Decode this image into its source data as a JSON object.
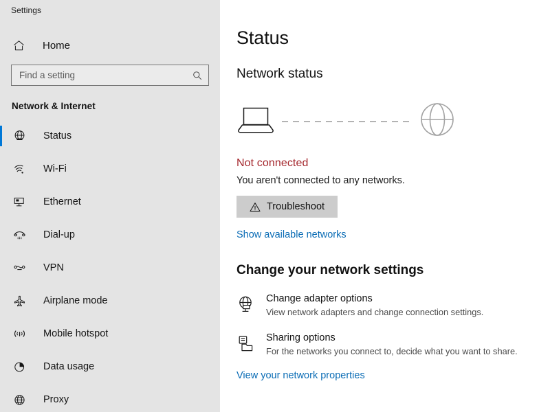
{
  "window": {
    "title": "Settings"
  },
  "sidebar": {
    "home_label": "Home",
    "home_icon": "home-icon",
    "search": {
      "placeholder": "Find a setting",
      "value": "",
      "icon": "search-icon"
    },
    "group_title": "Network & Internet",
    "selected_accent": "#0078d7",
    "background": "#e4e4e4",
    "items": [
      {
        "label": "Status",
        "icon": "network-status-icon",
        "selected": true
      },
      {
        "label": "Wi-Fi",
        "icon": "wifi-icon",
        "selected": false
      },
      {
        "label": "Ethernet",
        "icon": "ethernet-icon",
        "selected": false
      },
      {
        "label": "Dial-up",
        "icon": "dialup-phone-icon",
        "selected": false
      },
      {
        "label": "VPN",
        "icon": "vpn-icon",
        "selected": false
      },
      {
        "label": "Airplane mode",
        "icon": "airplane-icon",
        "selected": false
      },
      {
        "label": "Mobile hotspot",
        "icon": "hotspot-icon",
        "selected": false
      },
      {
        "label": "Data usage",
        "icon": "pie-chart-icon",
        "selected": false
      },
      {
        "label": "Proxy",
        "icon": "globe-icon",
        "selected": false
      }
    ]
  },
  "main": {
    "page_title": "Status",
    "network_status_heading": "Network status",
    "diagram": {
      "device_icon": "laptop-icon",
      "link_icon": "dashed-connection-line",
      "internet_icon": "globe-icon",
      "connected": false
    },
    "status": {
      "title": "Not connected",
      "title_color": "#a4262c",
      "description": "You aren't connected to any networks."
    },
    "troubleshoot": {
      "label": "Troubleshoot",
      "icon": "warning-triangle-icon"
    },
    "show_networks_link": "Show available networks",
    "change_settings_heading": "Change your network settings",
    "options": [
      {
        "title": "Change adapter options",
        "subtitle": "View network adapters and change connection settings.",
        "icon": "network-adapter-icon"
      },
      {
        "title": "Sharing options",
        "subtitle": "For the networks you connect to, decide what you want to share.",
        "icon": "sharing-options-icon"
      }
    ],
    "view_properties_link": "View your network properties",
    "link_color": "#0a6cb5"
  }
}
